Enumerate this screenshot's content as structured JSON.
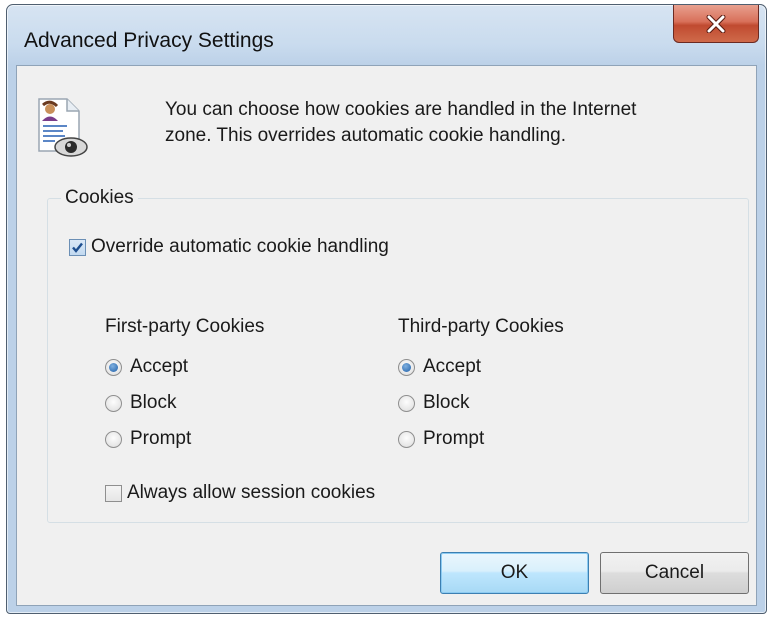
{
  "window": {
    "title": "Advanced Privacy Settings"
  },
  "intro": {
    "text": "You can choose how cookies are handled in the Internet\nzone.  This overrides automatic cookie handling."
  },
  "cookies": {
    "group_label": "Cookies",
    "override_label": "Override automatic cookie handling",
    "override_checked": true,
    "first_party": {
      "header": "First-party Cookies",
      "options": [
        "Accept",
        "Block",
        "Prompt"
      ],
      "selected": "Accept"
    },
    "third_party": {
      "header": "Third-party Cookies",
      "options": [
        "Accept",
        "Block",
        "Prompt"
      ],
      "selected": "Accept"
    },
    "session_label": "Always allow session cookies",
    "session_checked": false
  },
  "buttons": {
    "ok": "OK",
    "cancel": "Cancel"
  },
  "icons": {
    "close": "close-icon",
    "privacy": "privacy-document-eye-icon"
  },
  "colors": {
    "close_button": "#c75238",
    "accent_default_button": "#3c7fb1"
  }
}
